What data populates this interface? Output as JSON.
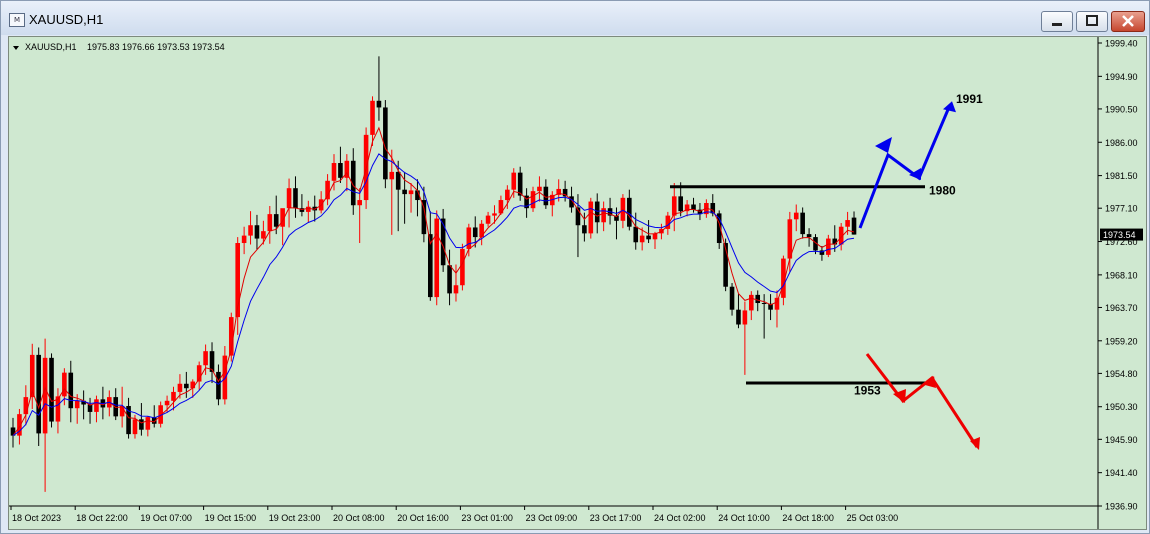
{
  "window": {
    "title": "XAUUSD,H1",
    "minimize_icon": "minimize-icon",
    "maximize_icon": "maximize-icon",
    "close_icon": "close-icon"
  },
  "chart_header": {
    "symbol_label": "XAUUSD,H1",
    "ohlc": "1975.83 1976.66 1973.53 1973.54"
  },
  "colors": {
    "background": "#cfe8d0",
    "bull_candle": "#ff0000",
    "bear_candle": "#000000",
    "fast_ma": "#e00000",
    "slow_ma": "#0000ee",
    "up_arrow": "#0000ee",
    "down_arrow": "#ee0000",
    "level_line": "#000000"
  },
  "chart_data": {
    "type": "candlestick",
    "title": "XAUUSD,H1",
    "ylim": [
      1936.9,
      1999.4
    ],
    "y_ticks": [
      "1999.40",
      "1994.90",
      "1990.50",
      "1986.00",
      "1981.50",
      "1977.10",
      "1972.60",
      "1968.10",
      "1963.70",
      "1959.20",
      "1954.80",
      "1950.30",
      "1945.90",
      "1941.40",
      "1936.90"
    ],
    "x_labels": [
      "18 Oct 2023",
      "18 Oct 22:00",
      "19 Oct 07:00",
      "19 Oct 15:00",
      "19 Oct 23:00",
      "20 Oct 08:00",
      "20 Oct 16:00",
      "23 Oct 01:00",
      "23 Oct 09:00",
      "23 Oct 17:00",
      "24 Oct 02:00",
      "24 Oct 10:00",
      "24 Oct 18:00",
      "25 Oct 03:00"
    ],
    "current_price": "1973.54",
    "candles": [
      [
        1947.5,
        1948.8,
        1944.8,
        1946.4
      ],
      [
        1946.4,
        1950.0,
        1945.2,
        1949.3
      ],
      [
        1949.3,
        1953.2,
        1947.8,
        1951.6
      ],
      [
        1951.6,
        1958.8,
        1950.0,
        1957.3
      ],
      [
        1957.3,
        1958.3,
        1945.0,
        1946.7
      ],
      [
        1946.7,
        1959.5,
        1938.8,
        1956.9
      ],
      [
        1956.9,
        1957.5,
        1947.5,
        1948.3
      ],
      [
        1948.3,
        1952.8,
        1946.7,
        1951.7
      ],
      [
        1951.7,
        1955.5,
        1950.5,
        1954.9
      ],
      [
        1954.9,
        1956.5,
        1948.2,
        1950.1
      ],
      [
        1950.1,
        1952.0,
        1948.0,
        1951.1
      ],
      [
        1951.1,
        1952.5,
        1948.6,
        1950.6
      ],
      [
        1950.6,
        1951.5,
        1948.0,
        1949.6
      ],
      [
        1949.6,
        1951.8,
        1948.2,
        1951.3
      ],
      [
        1951.3,
        1953.0,
        1948.6,
        1950.2
      ],
      [
        1950.2,
        1952.5,
        1949.0,
        1951.6
      ],
      [
        1951.6,
        1952.8,
        1948.5,
        1949.0
      ],
      [
        1949.0,
        1953.0,
        1947.5,
        1950.4
      ],
      [
        1950.4,
        1951.5,
        1946.0,
        1946.6
      ],
      [
        1946.6,
        1949.2,
        1946.0,
        1948.6
      ],
      [
        1948.6,
        1950.8,
        1946.4,
        1947.2
      ],
      [
        1947.2,
        1949.0,
        1946.3,
        1948.9
      ],
      [
        1948.9,
        1950.5,
        1947.5,
        1948.0
      ],
      [
        1948.0,
        1951.0,
        1947.5,
        1950.5
      ],
      [
        1950.5,
        1951.8,
        1949.5,
        1951.1
      ],
      [
        1951.1,
        1953.0,
        1949.8,
        1952.3
      ],
      [
        1952.3,
        1954.7,
        1951.4,
        1953.4
      ],
      [
        1953.4,
        1955.0,
        1951.5,
        1952.8
      ],
      [
        1952.8,
        1954.0,
        1951.5,
        1953.7
      ],
      [
        1953.7,
        1956.4,
        1952.6,
        1955.9
      ],
      [
        1955.9,
        1958.7,
        1954.6,
        1957.8
      ],
      [
        1957.8,
        1959.0,
        1953.5,
        1955.0
      ],
      [
        1955.0,
        1956.0,
        1950.5,
        1951.3
      ],
      [
        1951.3,
        1958.5,
        1950.6,
        1957.2
      ],
      [
        1957.2,
        1963.0,
        1956.4,
        1962.4
      ],
      [
        1962.4,
        1973.2,
        1960.0,
        1972.4
      ],
      [
        1972.4,
        1974.6,
        1970.9,
        1973.4
      ],
      [
        1973.4,
        1976.7,
        1972.2,
        1974.8
      ],
      [
        1974.8,
        1976.2,
        1971.5,
        1973.0
      ],
      [
        1973.0,
        1975.4,
        1972.2,
        1974.0
      ],
      [
        1974.0,
        1977.4,
        1972.3,
        1976.3
      ],
      [
        1976.3,
        1978.8,
        1973.6,
        1974.6
      ],
      [
        1974.6,
        1977.0,
        1972.1,
        1977.1
      ],
      [
        1977.1,
        1981.1,
        1974.5,
        1979.8
      ],
      [
        1979.8,
        1981.4,
        1975.8,
        1977.1
      ],
      [
        1977.1,
        1979.0,
        1976.0,
        1976.6
      ],
      [
        1976.6,
        1978.1,
        1975.2,
        1977.3
      ],
      [
        1977.3,
        1978.8,
        1975.3,
        1976.8
      ],
      [
        1976.8,
        1979.4,
        1976.4,
        1978.3
      ],
      [
        1978.3,
        1981.7,
        1977.5,
        1980.8
      ],
      [
        1980.8,
        1984.4,
        1979.5,
        1983.2
      ],
      [
        1983.2,
        1985.4,
        1980.5,
        1981.2
      ],
      [
        1981.2,
        1984.4,
        1979.4,
        1983.5
      ],
      [
        1983.5,
        1985.2,
        1976.2,
        1977.5
      ],
      [
        1977.5,
        1979.8,
        1972.4,
        1978.2
      ],
      [
        1978.2,
        1988.0,
        1977.0,
        1987.0
      ],
      [
        1987.0,
        1992.2,
        1985.5,
        1991.6
      ],
      [
        1991.6,
        1997.6,
        1988.9,
        1990.7
      ],
      [
        1990.7,
        1991.7,
        1979.8,
        1981.0
      ],
      [
        1981.0,
        1985.0,
        1973.5,
        1982.0
      ],
      [
        1982.0,
        1983.5,
        1974.0,
        1979.6
      ],
      [
        1979.6,
        1982.0,
        1975.0,
        1979.0
      ],
      [
        1979.0,
        1980.5,
        1976.5,
        1979.5
      ],
      [
        1979.5,
        1981.0,
        1976.0,
        1978.2
      ],
      [
        1978.2,
        1980.0,
        1972.5,
        1973.6
      ],
      [
        1973.6,
        1976.7,
        1964.6,
        1965.1
      ],
      [
        1965.1,
        1976.8,
        1964.0,
        1975.7
      ],
      [
        1975.7,
        1977.0,
        1968.5,
        1969.4
      ],
      [
        1969.4,
        1971.5,
        1964.0,
        1965.6
      ],
      [
        1965.6,
        1969.5,
        1964.5,
        1966.7
      ],
      [
        1966.7,
        1972.3,
        1966.0,
        1971.6
      ],
      [
        1971.6,
        1975.0,
        1970.6,
        1974.5
      ],
      [
        1974.5,
        1976.0,
        1971.8,
        1973.2
      ],
      [
        1973.2,
        1975.5,
        1972.1,
        1975.0
      ],
      [
        1975.0,
        1976.6,
        1974.6,
        1976.1
      ],
      [
        1976.1,
        1977.5,
        1975.0,
        1976.4
      ],
      [
        1976.4,
        1978.8,
        1976.2,
        1978.2
      ],
      [
        1978.2,
        1980.2,
        1977.0,
        1979.6
      ],
      [
        1979.6,
        1982.5,
        1978.5,
        1981.9
      ],
      [
        1981.9,
        1982.7,
        1978.1,
        1978.8
      ],
      [
        1978.8,
        1979.8,
        1975.8,
        1977.1
      ],
      [
        1977.1,
        1980.0,
        1976.6,
        1979.4
      ],
      [
        1979.4,
        1981.4,
        1978.0,
        1980.0
      ],
      [
        1980.0,
        1981.0,
        1977.0,
        1977.5
      ],
      [
        1977.5,
        1979.4,
        1976.0,
        1978.9
      ],
      [
        1978.9,
        1981.0,
        1978.0,
        1979.7
      ],
      [
        1979.7,
        1980.8,
        1978.0,
        1978.7
      ],
      [
        1978.7,
        1980.0,
        1976.5,
        1977.2
      ],
      [
        1977.2,
        1979.0,
        1970.5,
        1974.8
      ],
      [
        1974.8,
        1976.5,
        1972.6,
        1973.7
      ],
      [
        1973.7,
        1978.5,
        1973.0,
        1978.0
      ],
      [
        1978.0,
        1979.1,
        1973.7,
        1975.2
      ],
      [
        1975.2,
        1978.0,
        1974.0,
        1977.1
      ],
      [
        1977.1,
        1978.5,
        1974.9,
        1976.1
      ],
      [
        1976.1,
        1977.2,
        1972.9,
        1975.4
      ],
      [
        1975.4,
        1979.0,
        1974.4,
        1978.5
      ],
      [
        1978.5,
        1979.6,
        1974.1,
        1974.6
      ],
      [
        1974.6,
        1976.5,
        1971.5,
        1972.5
      ],
      [
        1972.5,
        1974.5,
        1971.4,
        1973.4
      ],
      [
        1973.4,
        1975.5,
        1972.4,
        1972.9
      ],
      [
        1972.9,
        1973.9,
        1971.6,
        1973.7
      ],
      [
        1973.7,
        1975.0,
        1972.9,
        1974.3
      ],
      [
        1974.3,
        1976.6,
        1973.5,
        1976.1
      ],
      [
        1976.1,
        1980.5,
        1974.0,
        1978.7
      ],
      [
        1978.7,
        1980.6,
        1976.0,
        1976.7
      ],
      [
        1976.7,
        1978.2,
        1976.0,
        1977.6
      ],
      [
        1977.6,
        1978.5,
        1976.5,
        1976.9
      ],
      [
        1976.9,
        1977.8,
        1975.5,
        1976.3
      ],
      [
        1976.3,
        1978.3,
        1975.8,
        1977.8
      ],
      [
        1977.8,
        1979.0,
        1976.0,
        1976.4
      ],
      [
        1976.4,
        1976.8,
        1971.6,
        1972.4
      ],
      [
        1972.4,
        1973.0,
        1965.9,
        1966.5
      ],
      [
        1966.5,
        1967.0,
        1962.6,
        1963.4
      ],
      [
        1963.4,
        1965.5,
        1960.9,
        1961.4
      ],
      [
        1961.4,
        1964.5,
        1954.6,
        1963.3
      ],
      [
        1963.3,
        1965.9,
        1962.0,
        1965.4
      ],
      [
        1965.4,
        1966.0,
        1963.2,
        1964.3
      ],
      [
        1964.3,
        1965.5,
        1959.5,
        1964.2
      ],
      [
        1964.2,
        1965.5,
        1962.0,
        1963.4
      ],
      [
        1963.4,
        1966.0,
        1961.0,
        1965.0
      ],
      [
        1965.0,
        1970.7,
        1964.0,
        1970.3
      ],
      [
        1970.3,
        1976.6,
        1968.5,
        1975.6
      ],
      [
        1975.6,
        1977.6,
        1974.0,
        1976.5
      ],
      [
        1976.5,
        1977.2,
        1973.0,
        1973.6
      ],
      [
        1973.6,
        1974.4,
        1971.9,
        1973.2
      ],
      [
        1973.2,
        1973.6,
        1970.9,
        1971.4
      ],
      [
        1971.4,
        1972.0,
        1970.0,
        1970.8
      ],
      [
        1970.8,
        1973.5,
        1970.5,
        1973.0
      ],
      [
        1973.0,
        1974.8,
        1971.2,
        1972.2
      ],
      [
        1972.2,
        1975.1,
        1971.4,
        1974.6
      ],
      [
        1974.6,
        1976.6,
        1973.5,
        1975.5
      ],
      [
        1975.83,
        1976.66,
        1973.53,
        1973.54
      ]
    ],
    "annotations": [
      {
        "label": "1991",
        "price": 1991,
        "color": "#0000ee"
      },
      {
        "label": "1980",
        "price": 1980,
        "color": "#000000"
      },
      {
        "label": "1953",
        "price": 1953,
        "color": "#000000"
      }
    ]
  }
}
